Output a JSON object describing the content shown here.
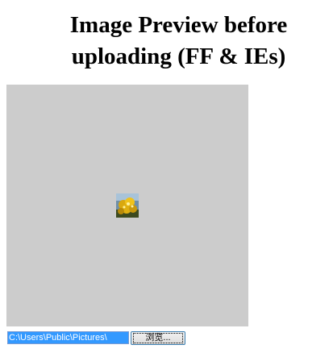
{
  "header": {
    "title_line1": "Image Preview before",
    "title_line2": "uploading (FF & IEs)"
  },
  "preview": {
    "background_color": "#cccccc",
    "thumbnail_icon": "flower-photo-thumbnail"
  },
  "file_input": {
    "value": "C:\\Users\\Public\\Pictures\\",
    "browse_label": "浏览..."
  }
}
